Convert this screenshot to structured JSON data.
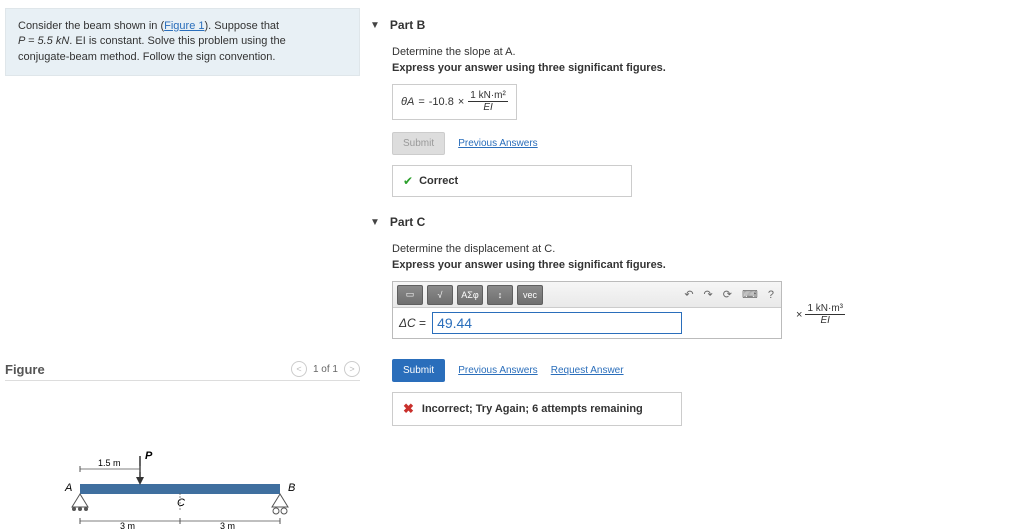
{
  "problem": {
    "prefix": "Consider the beam shown in (",
    "figure_link": "Figure 1",
    "suffix1": "). Suppose that",
    "line2a": "P = 5.5 kN",
    "line2b": ". EI is constant. Solve this problem using the",
    "line3": "conjugate-beam method. Follow the sign convention."
  },
  "figure": {
    "title": "Figure",
    "nav_text": "1 of 1",
    "labels": {
      "P": "P",
      "A": "A",
      "B": "B",
      "C": "C",
      "d15": "1.5 m",
      "d3a": "3 m",
      "d3b": "3 m"
    }
  },
  "partB": {
    "title": "Part B",
    "instr1": "Determine the slope at A.",
    "instr2": "Express your answer using three significant figures.",
    "theta_var": "θA",
    "eq": " = ",
    "value": "-10.8",
    "times": " × ",
    "unit_num": "1 kN·m²",
    "unit_den": "EI",
    "submit": "Submit",
    "prev": "Previous Answers",
    "feedback": "Correct"
  },
  "partC": {
    "title": "Part C",
    "instr1": "Determine the displacement at C.",
    "instr2": "Express your answer using three significant figures.",
    "delta_var": "ΔC",
    "eq": " = ",
    "value": "49.44",
    "times": "×",
    "unit_num": "1 kN·m³",
    "unit_den": "EI",
    "submit": "Submit",
    "prev": "Previous Answers",
    "request": "Request Answer",
    "feedback": "Incorrect; Try Again; 6 attempts remaining",
    "toolbar": {
      "sqrt": "√",
      "sigma": "ΑΣφ",
      "updown": "↕",
      "vec": "vec",
      "undo": "↶",
      "redo": "↷",
      "reset": "⟳",
      "kb": "⌨",
      "help": "?"
    }
  }
}
